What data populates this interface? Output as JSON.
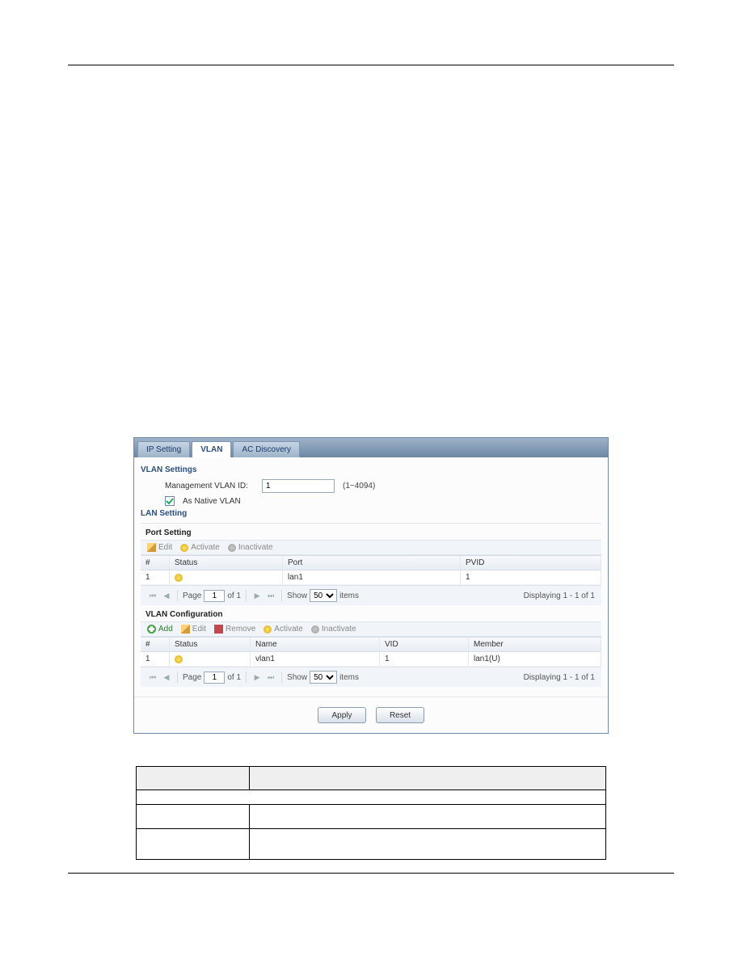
{
  "tabs": {
    "ip": "IP Setting",
    "vlan": "VLAN",
    "ac": "AC Discovery"
  },
  "vlan_settings": {
    "title": "VLAN Settings",
    "mgmt_label": "Management VLAN ID:",
    "mgmt_value": "1",
    "mgmt_hint": "(1~4094)",
    "native_label": "As Native VLAN"
  },
  "lan": {
    "title": "LAN Setting",
    "port_title": "Port Setting"
  },
  "toolbar": {
    "edit": "Edit",
    "activate": "Activate",
    "inactivate": "Inactivate",
    "add": "Add",
    "remove": "Remove"
  },
  "grid_port": {
    "headers": {
      "idx": "#",
      "status": "Status",
      "port": "Port",
      "pvid": "PVID"
    },
    "row": {
      "idx": "1",
      "port": "lan1",
      "pvid": "1"
    }
  },
  "pager": {
    "page_label": "Page",
    "page_value": "1",
    "of_label": "of 1",
    "show_label": "Show",
    "show_value": "50",
    "items_label": "items",
    "display_label": "Displaying 1 - 1 of 1"
  },
  "vlan_cfg": {
    "title": "VLAN Configuration",
    "headers": {
      "idx": "#",
      "status": "Status",
      "name": "Name",
      "vid": "VID",
      "member": "Member"
    },
    "row": {
      "idx": "1",
      "name": "vlan1",
      "vid": "1",
      "member": "lan1(U)"
    }
  },
  "buttons": {
    "apply": "Apply",
    "reset": "Reset"
  }
}
